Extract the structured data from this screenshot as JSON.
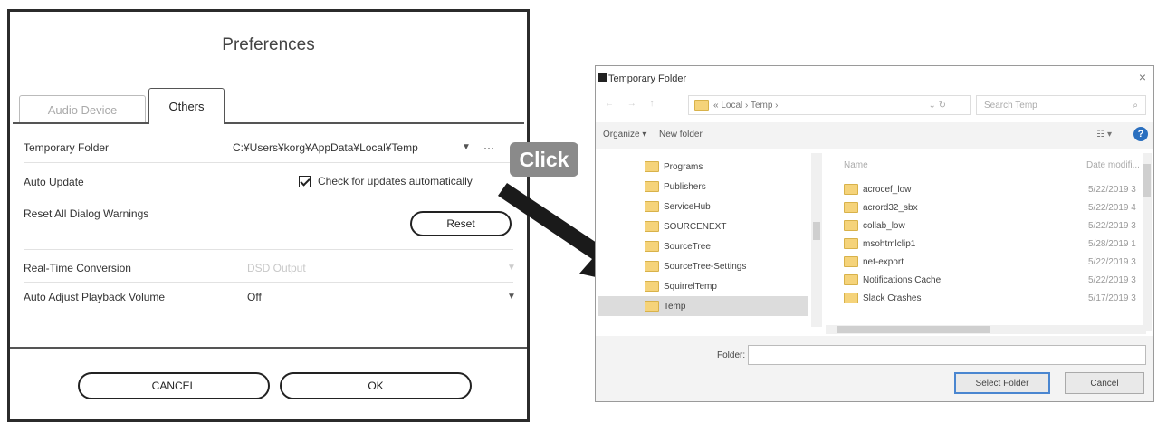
{
  "preferences": {
    "title": "Preferences",
    "tabs": [
      {
        "label": "Audio Device",
        "active": false
      },
      {
        "label": "Others",
        "active": true
      }
    ],
    "rows": {
      "temp_folder": {
        "label": "Temporary Folder",
        "value": "C:¥Users¥korg¥AppData¥Local¥Temp",
        "dropdown": "▼",
        "more": "···"
      },
      "auto_update": {
        "label": "Auto Update",
        "checkbox_label": "Check for updates automatically",
        "checked": true
      },
      "reset_warnings": {
        "label": "Reset All Dialog Warnings",
        "button": "Reset"
      },
      "realtime": {
        "label": "Real-Time Conversion",
        "value": "DSD Output",
        "dropdown": "▼"
      },
      "auto_adjust": {
        "label": "Auto Adjust Playback Volume",
        "value": "Off",
        "dropdown": "▼"
      }
    },
    "cancel_label": "CANCEL",
    "ok_label": "OK"
  },
  "annotation": {
    "click_label": "Click",
    "arrow_color": "#1a1a1a",
    "badge_color": "#8a8a8a"
  },
  "folder_dialog": {
    "title": "Temporary Folder",
    "close": "×",
    "nav_arrows": "← → ↑",
    "address": "« Local › Temp ›",
    "address_controls": "⌄ ↻",
    "search_placeholder": "Search Temp",
    "search_icon": "⌕",
    "toolbar": {
      "organize": "Organize ▾",
      "new_folder": "New folder",
      "view": "☷ ▾",
      "help": "?"
    },
    "tree": [
      "Programs",
      "Publishers",
      "ServiceHub",
      "SOURCENEXT",
      "SourceTree",
      "SourceTree-Settings",
      "SquirrelTemp",
      "Temp"
    ],
    "selected_tree_item": "Temp",
    "columns": {
      "name": "Name",
      "date": "Date modifi..."
    },
    "files": [
      {
        "name": "acrocef_low",
        "date": "5/22/2019 3"
      },
      {
        "name": "acrord32_sbx",
        "date": "5/22/2019 4"
      },
      {
        "name": "collab_low",
        "date": "5/22/2019 3"
      },
      {
        "name": "msohtmlclip1",
        "date": "5/28/2019 1"
      },
      {
        "name": "net-export",
        "date": "5/22/2019 3"
      },
      {
        "name": "Notifications Cache",
        "date": "5/22/2019 3"
      },
      {
        "name": "Slack Crashes",
        "date": "5/17/2019 3"
      }
    ],
    "folder_label": "Folder:",
    "folder_value": "",
    "select_label": "Select Folder",
    "cancel_label": "Cancel"
  }
}
